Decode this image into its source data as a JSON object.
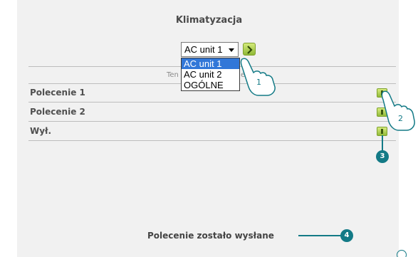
{
  "window": {
    "title": "Klimatyzacja"
  },
  "unit_select": {
    "value": "AC unit 1",
    "options": [
      "AC unit 1",
      "AC unit 2",
      "OGÓLNE"
    ],
    "selected_index": 0
  },
  "section_label_left": "Ten",
  "section_label_right": "er",
  "commands": [
    {
      "label": "Polecenie 1"
    },
    {
      "label": "Polecenie 2"
    },
    {
      "label": "Wył."
    }
  ],
  "status_message": "Polecenie zostało wysłane",
  "callouts": [
    "1",
    "2",
    "3",
    "4"
  ],
  "colors": {
    "panel_bg": "#f1f1f1",
    "accent": "#137a86",
    "button_green": "#93bb3a",
    "selection_blue": "#3177d8"
  },
  "icons": {
    "go": "arrow-right-icon",
    "send": "send-command-icon",
    "pointer": "pointing-hand-icon"
  }
}
